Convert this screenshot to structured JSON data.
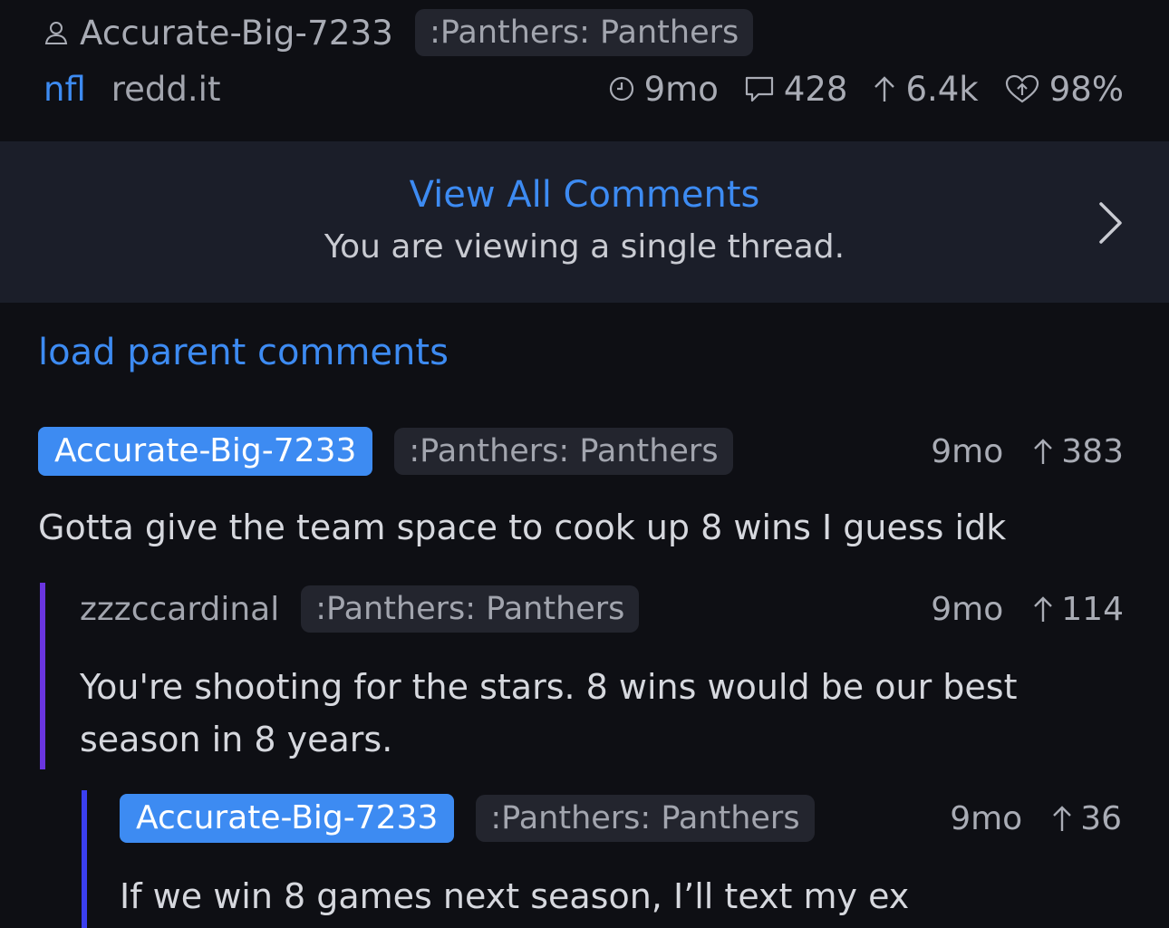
{
  "post": {
    "author": "Accurate-Big-7233",
    "author_flair": ":Panthers: Panthers",
    "subreddit": "nfl",
    "domain": "redd.it",
    "age": "9mo",
    "comments": "428",
    "score": "6.4k",
    "upvote_ratio": "98%"
  },
  "banner": {
    "title": "View All Comments",
    "subtitle": "You are viewing a single thread."
  },
  "load_parent_label": "load parent comments",
  "comments": [
    {
      "author": "Accurate-Big-7233",
      "flair": ":Panthers: Panthers",
      "age": "9mo",
      "score": "383",
      "body": "Gotta give the team space to cook up 8 wins I guess idk"
    },
    {
      "author": "zzzccardinal",
      "flair": ":Panthers: Panthers",
      "age": "9mo",
      "score": "114",
      "body": "You're shooting for the stars. 8 wins would be our best season in 8 years."
    },
    {
      "author": "Accurate-Big-7233",
      "flair": ":Panthers: Panthers",
      "age": "9mo",
      "score": "36",
      "body": "If we win 8 games next season, I’ll text my ex"
    }
  ],
  "colors": {
    "background": "#0e0f14",
    "banner": "#1b1e29",
    "accent": "#3d8bf2",
    "thread_bar_level1": "#6a35e0",
    "thread_bar_level2": "#3b3ff0"
  }
}
